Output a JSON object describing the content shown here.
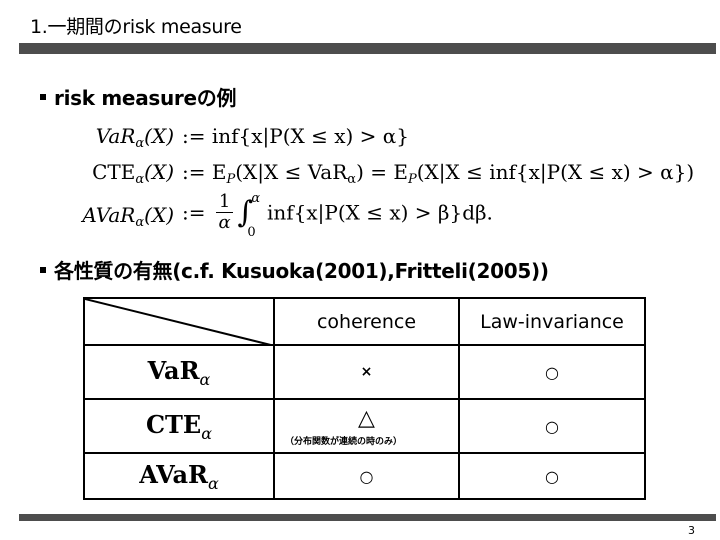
{
  "slide": {
    "title": "1.一期間のrisk measure",
    "page_number": "3"
  },
  "section1": {
    "heading": "risk measureの例",
    "formulas": [
      {
        "name": "VaR",
        "lhs_main": "VaR",
        "lhs_sub": "α",
        "lhs_arg": "(X)",
        "rhs": ":= inf{x|P(X ≤ x) > α}"
      },
      {
        "name": "CTE",
        "lhs_main": "CTE",
        "lhs_sub": "α",
        "lhs_arg": "(X)",
        "rhs": ":= E_P(X|X ≤ VaR_α) = E_P(X|X ≤ inf{x|P(X ≤ x) > α})",
        "rhs_part1": ":= E",
        "rhs_part1_sub": "P",
        "rhs_part2": "(X|X ≤ VaR",
        "rhs_part2_sub": "α",
        "rhs_part3": ") = E",
        "rhs_part3_sub": "P",
        "rhs_part4": "(X|X ≤ inf{x|P(X ≤ x) > α})"
      },
      {
        "name": "AVaR",
        "lhs_main": "AVaR",
        "lhs_sub": "α",
        "lhs_arg": "(X)",
        "rhs": ":= (1/α) ∫_0^α inf{x|P(X ≤ x) > β}dβ.",
        "prefix": ":=",
        "frac_num": "1",
        "frac_den": "α",
        "int_upper": "α",
        "int_lower": "0",
        "integrand": "inf{x|P(X ≤ x) > β}dβ."
      }
    ]
  },
  "section2": {
    "heading": "各性質の有無(c.f. Kusuoka(2001),Fritteli(2005))",
    "table": {
      "columns": [
        "coherence",
        "Law-invariance"
      ],
      "rows": [
        {
          "label_main": "VaR",
          "label_sub": "α",
          "coherence": "×",
          "coherence_note": "",
          "law_invariance": "○"
        },
        {
          "label_main": "CTE",
          "label_sub": "α",
          "coherence": "△",
          "coherence_note": "（分布関数が連続の時のみ）",
          "law_invariance": "○"
        },
        {
          "label_main": "AVaR",
          "label_sub": "α",
          "coherence": "○",
          "coherence_note": "",
          "law_invariance": "○"
        }
      ]
    }
  }
}
